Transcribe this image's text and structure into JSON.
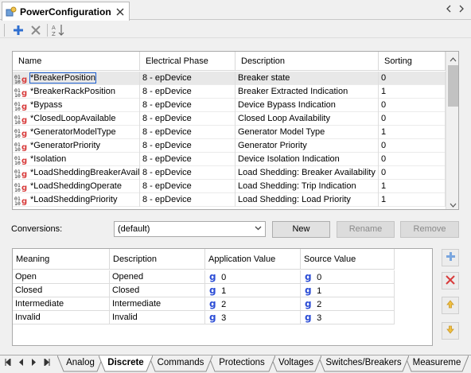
{
  "editor_tab": {
    "title": "PowerConfiguration",
    "close_symbol": "✕"
  },
  "columns": [
    "Name",
    "Electrical Phase",
    "Description",
    "Sorting"
  ],
  "rows": [
    {
      "name": "*BreakerPosition",
      "phase": "8 - epDevice",
      "desc": "Breaker state",
      "sort": "0",
      "selected": true
    },
    {
      "name": "*BreakerRackPosition",
      "phase": "8 - epDevice",
      "desc": "Breaker Extracted Indication",
      "sort": "1"
    },
    {
      "name": "*Bypass",
      "phase": "8 - epDevice",
      "desc": "Device Bypass Indication",
      "sort": "0"
    },
    {
      "name": "*ClosedLoopAvailable",
      "phase": "8 - epDevice",
      "desc": "Closed Loop Availability",
      "sort": "0"
    },
    {
      "name": "*GeneratorModelType",
      "phase": "8 - epDevice",
      "desc": "Generator Model Type",
      "sort": "1"
    },
    {
      "name": "*GeneratorPriority",
      "phase": "8 - epDevice",
      "desc": "Generator Priority",
      "sort": "0"
    },
    {
      "name": "*Isolation",
      "phase": "8 - epDevice",
      "desc": "Device Isolation Indication",
      "sort": "0"
    },
    {
      "name": "*LoadSheddingBreakerAvaila",
      "phase": "8 - epDevice",
      "desc": "Load Shedding: Breaker Availability",
      "sort": "0"
    },
    {
      "name": "*LoadSheddingOperate",
      "phase": "8 - epDevice",
      "desc": "Load Shedding: Trip Indication",
      "sort": "1"
    },
    {
      "name": "*LoadSheddingPriority",
      "phase": "8 - epDevice",
      "desc": "Load Shedding: Load Priority",
      "sort": "1"
    }
  ],
  "conversions": {
    "label": "Conversions:",
    "selected": "(default)",
    "new_label": "New",
    "rename_label": "Rename",
    "remove_label": "Remove"
  },
  "conv_columns": [
    "Meaning",
    "Description",
    "Application Value",
    "Source Value"
  ],
  "conv_rows": [
    {
      "meaning": "Open",
      "desc": "Opened",
      "app": "0",
      "src": "0"
    },
    {
      "meaning": "Closed",
      "desc": "Closed",
      "app": "1",
      "src": "1"
    },
    {
      "meaning": "Intermediate",
      "desc": "Intermediate",
      "app": "2",
      "src": "2"
    },
    {
      "meaning": "Invalid",
      "desc": "Invalid",
      "app": "3",
      "src": "3"
    }
  ],
  "value_glyph": "g",
  "bottom_tabs": [
    "Analog",
    "Discrete",
    "Commands",
    "Protections",
    "Voltages",
    "Switches/Breakers",
    "Measureme"
  ],
  "active_bottom_tab": "Discrete",
  "colors": {
    "accent": "#2e4fd6",
    "remove_red": "#d83b3b",
    "arrow_gold": "#f0c040"
  }
}
